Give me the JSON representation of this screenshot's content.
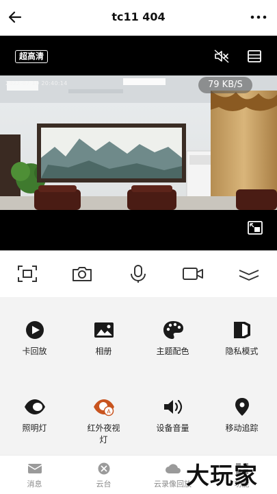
{
  "header": {
    "title": "tc11 404",
    "back_icon": "arrow-left-icon",
    "more_icon": "more-horizontal-icon"
  },
  "player": {
    "quality_label": "超高清",
    "timestamp": "2022-07-10 20:40:14",
    "speed": "79 KB/S",
    "mute_icon": "speaker-muted-icon",
    "layout_icon": "layout-icon",
    "fullscreen_icon": "fullscreen-icon"
  },
  "toolbar": [
    "screenshot-frame-icon",
    "camera-icon",
    "microphone-icon",
    "video-record-icon",
    "collapse-icon"
  ],
  "functions": [
    {
      "label": "卡回放",
      "icon": "play-circle-icon"
    },
    {
      "label": "相册",
      "icon": "album-icon"
    },
    {
      "label": "主题配色",
      "icon": "palette-icon"
    },
    {
      "label": "隐私模式",
      "icon": "privacy-icon"
    },
    {
      "label": "照明灯",
      "icon": "eye-light-icon"
    },
    {
      "label": "红外夜视灯",
      "icon": "infrared-icon",
      "label_line1": "红外夜视",
      "label_line2": "灯"
    },
    {
      "label": "设备音量",
      "icon": "volume-icon"
    },
    {
      "label": "移动追踪",
      "icon": "location-pin-icon"
    }
  ],
  "tabs": [
    {
      "label": "消息",
      "icon": "message-icon"
    },
    {
      "label": "云台",
      "icon": "ptz-icon"
    },
    {
      "label": "云录像回放",
      "icon": "cloud-icon"
    },
    {
      "label": "功能",
      "icon": "function-icon"
    }
  ],
  "watermark": "大玩家",
  "colors": {
    "background": "#ffffff",
    "player_bg": "#000000",
    "panel_bg": "#f3f3f3",
    "infrared_accent": "#c8541f",
    "tab_text": "#8a8a8a"
  }
}
